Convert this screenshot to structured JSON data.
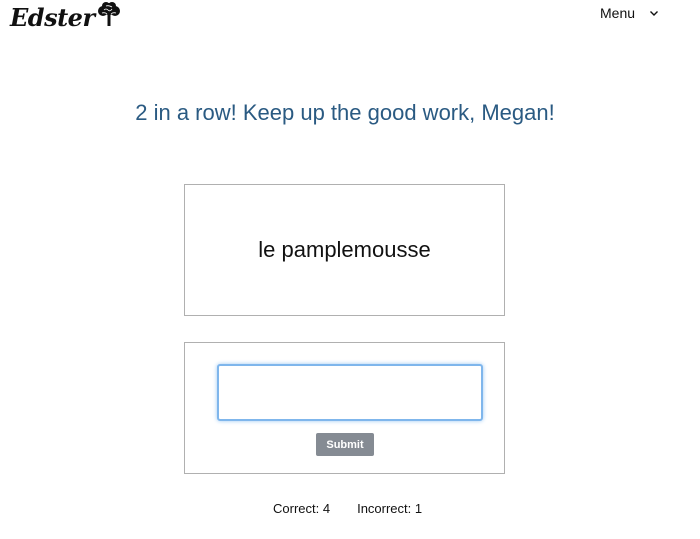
{
  "header": {
    "logo_text": "Edster",
    "logo_icon": "tree-icon",
    "menu_label": "Menu",
    "menu_icon": "chevron-down-icon"
  },
  "main": {
    "headline": "2 in a row! Keep up the good work, Megan!",
    "flashcard_word": "le pamplemousse",
    "answer_value": "",
    "submit_label": "Submit"
  },
  "score": {
    "correct_label": "Correct: 4",
    "incorrect_label": "Incorrect: 1"
  },
  "colors": {
    "headline": "#2a5a82",
    "submit_bg": "#858b93",
    "input_focus": "#7fb6ec"
  }
}
